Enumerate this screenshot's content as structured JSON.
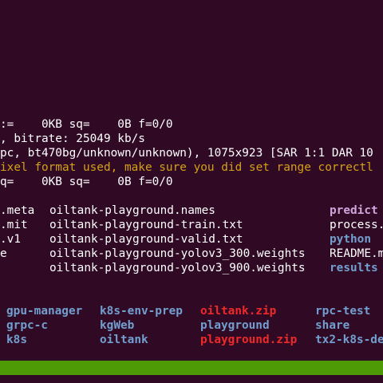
{
  "terminal": {
    "colors": {
      "background": "#300a24",
      "text": "#ffffff",
      "warning": "#d4a017",
      "directory": "#729fcf",
      "executable": "#cfa6dc",
      "archive": "#ef2929",
      "status_bar": "#4e9a06"
    },
    "log_lines": [
      ":=    0KB sq=    0B f=0/0",
      ", bitrate: 25049 kb/s",
      "pc, bt470bg/unknown/unknown), 1075x923 [SAR 1:1 DAR 10",
      "ixel format used, make sure you did set range correctl",
      "q=    0KB sq=    0B f=0/0"
    ],
    "listing_rows": [
      {
        "c1": ".meta",
        "c2": "oiltank-playground.names",
        "c3": "predict"
      },
      {
        "c1": ".mit",
        "c2": "oiltank-playground-train.txt",
        "c3": "process."
      },
      {
        "c1": ".v1",
        "c2": "oiltank-playground-valid.txt",
        "c3": "python"
      },
      {
        "c1": "e",
        "c2": "oiltank-playground-yolov3_300.weights",
        "c3": "README.m"
      },
      {
        "c1": "",
        "c2": "oiltank-playground-yolov3_900.weights",
        "c3": "results"
      }
    ],
    "dir_listing": [
      [
        "gpu-manager",
        "k8s-env-prep",
        "oiltank.zip",
        "rpc-test"
      ],
      [
        "grpc-c",
        "kgWeb",
        "playground",
        "share"
      ],
      [
        "k8s",
        "oiltank",
        "playground.zip",
        "tx2-k8s-de"
      ]
    ]
  }
}
